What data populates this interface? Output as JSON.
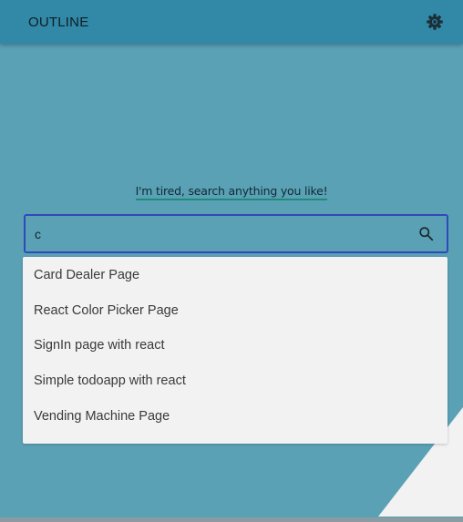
{
  "header": {
    "title": "OUTLINE",
    "settings_icon": "gear-icon"
  },
  "tagline": "I'm tired, search anything you like!",
  "search": {
    "value": "c",
    "icon": "search-icon"
  },
  "suggestions": [
    "Card Dealer Page",
    "React Color Picker Page",
    "SignIn page with react",
    "Simple todoapp with react",
    "Vending Machine Page"
  ],
  "colors": {
    "background": "#5ba1b6",
    "header": "#3189a7",
    "accent_border": "#3049b8",
    "underline": "#1e8a78"
  }
}
